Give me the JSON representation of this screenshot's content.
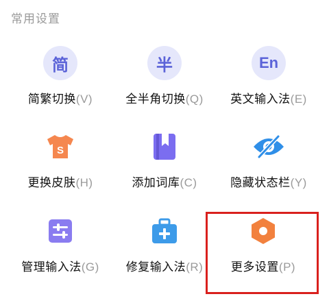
{
  "section": {
    "title": "常用设置"
  },
  "items": [
    {
      "name": "简繁切换",
      "key": "(V)",
      "icon_glyph": "简",
      "icon": "simplified-traditional-icon"
    },
    {
      "name": "全半角切换",
      "key": "(Q)",
      "icon_glyph": "半",
      "icon": "full-half-width-icon"
    },
    {
      "name": "英文输入法",
      "key": "(E)",
      "icon_glyph": "En",
      "icon": "english-input-icon"
    },
    {
      "name": "更换皮肤",
      "key": "(H)",
      "icon": "tshirt-skin-icon"
    },
    {
      "name": "添加词库",
      "key": "(C)",
      "icon": "bookmark-dictionary-icon"
    },
    {
      "name": "隐藏状态栏",
      "key": "(Y)",
      "icon": "eye-hidden-icon"
    },
    {
      "name": "管理输入法",
      "key": "(G)",
      "icon": "sliders-manage-icon"
    },
    {
      "name": "修复输入法",
      "key": "(R)",
      "icon": "toolbox-repair-icon"
    },
    {
      "name": "更多设置",
      "key": "(P)",
      "icon": "hexagon-settings-icon"
    }
  ],
  "colors": {
    "icon_circle_bg": "#e5e7fb",
    "icon_circle_fg": "#5b63d8",
    "skin_orange": "#f5874f",
    "dictionary_purple": "#7b6df0",
    "eye_blue": "#2f8fe8",
    "manage_purple": "#8a7cf0",
    "repair_blue": "#3d9be9",
    "settings_orange": "#f2813e",
    "highlight_red": "#d9201d"
  }
}
